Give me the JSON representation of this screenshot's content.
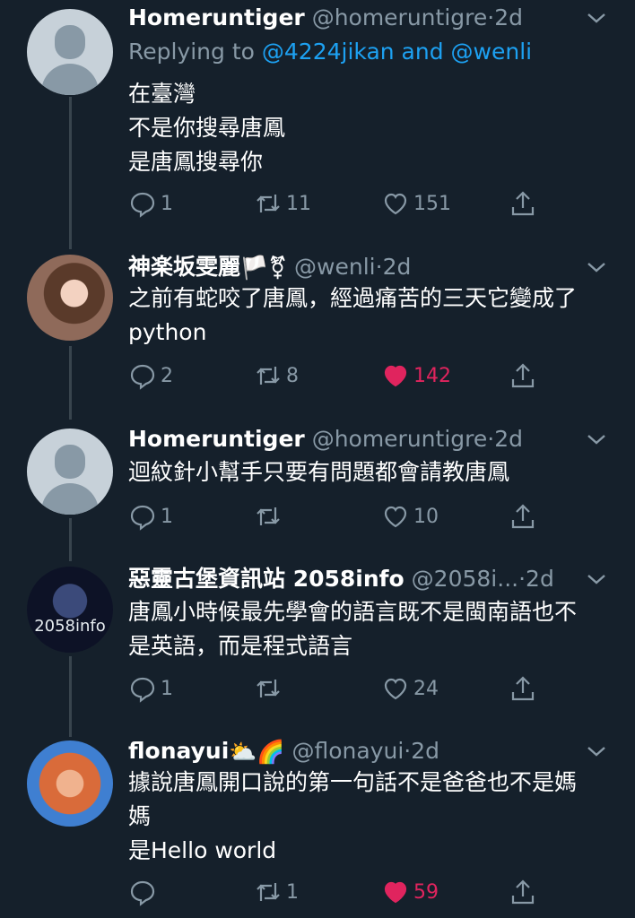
{
  "tweets": [
    {
      "name": "Homeruntiger",
      "handle": "@homeruntigre",
      "time": "2d",
      "replying_prefix": "Replying to ",
      "replying_mentions": "@4224jikan and @wenli",
      "lines": [
        "在臺灣",
        "不是你搜尋唐鳳",
        "是唐鳳搜尋你"
      ],
      "replies": "1",
      "retweets": "11",
      "likes": "151",
      "liked": false
    },
    {
      "name": "神楽坂雯麗",
      "name_emoji": "🏳️⚧",
      "handle": "@wenli",
      "time": "2d",
      "lines": [
        "之前有蛇咬了唐鳳，經過痛苦的三天它變成了",
        "python"
      ],
      "replies": "2",
      "retweets": "8",
      "likes": "142",
      "liked": true
    },
    {
      "name": "Homeruntiger",
      "handle": "@homeruntigre",
      "time": "2d",
      "lines": [
        "迴紋針小幫手只要有問題都會請教唐鳳"
      ],
      "replies": "1",
      "retweets": "",
      "likes": "10",
      "liked": false
    },
    {
      "name": "惡靈古堡資訊站 2058info",
      "handle": "@2058i...",
      "time": "2d",
      "avatar_text": "2058info",
      "lines": [
        "唐鳳小時候最先學會的語言既不是閩南語也不",
        "是英語，而是程式語言"
      ],
      "replies": "1",
      "retweets": "",
      "likes": "24",
      "liked": false
    },
    {
      "name": "flonayui",
      "name_emoji": "⛅🌈",
      "handle": "@flonayui",
      "time": "2d",
      "lines": [
        "據說唐鳳開口說的第一句話不是爸爸也不是媽",
        "媽",
        "是Hello world"
      ],
      "replies": "",
      "retweets": "1",
      "likes": "59",
      "liked": true
    }
  ],
  "separator": "·",
  "colors": {
    "background": "#15202b",
    "secondary_text": "#8899a6",
    "link": "#1da1f2",
    "like_active": "#e0245e",
    "thread_line": "#38444d"
  },
  "icons": [
    "reply-icon",
    "retweet-icon",
    "like-icon",
    "share-icon",
    "chevron-down-icon"
  ]
}
